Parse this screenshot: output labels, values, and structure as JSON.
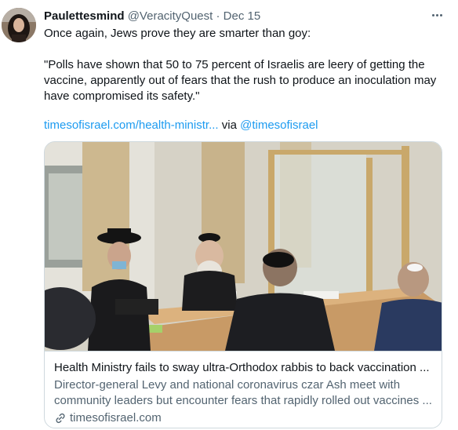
{
  "tweet": {
    "author_name": "Paulettesmind",
    "handle": "@VeracityQuest",
    "separator": "·",
    "date": "Dec 15",
    "line1": "Once again, Jews prove they are smarter than goy:",
    "quote": "\"Polls have shown that 50 to 75 percent of Israelis are leery of getting the vaccine, apparently out of fears that the rush to produce an inoculation may have compromised its safety.\"",
    "link_text": "timesofisrael.com/health-ministr...",
    "via_text": " via ",
    "via_handle": "@timesofisrael"
  },
  "card": {
    "title": "Health Ministry fails to sway ultra-Orthodox rabbis to back vaccination ...",
    "desc_line1": "Director-general Levy and national coronavirus czar Ash meet with",
    "desc_line2": "community leaders but encounter fears that rapidly rolled out vaccines ...",
    "domain": "timesofisrael.com"
  },
  "icons": {
    "more": "more-dots-icon",
    "link": "link-chain-icon"
  },
  "colors": {
    "link_blue": "#1d9bf0",
    "secondary_text": "#536471",
    "border": "#cfd9de"
  }
}
